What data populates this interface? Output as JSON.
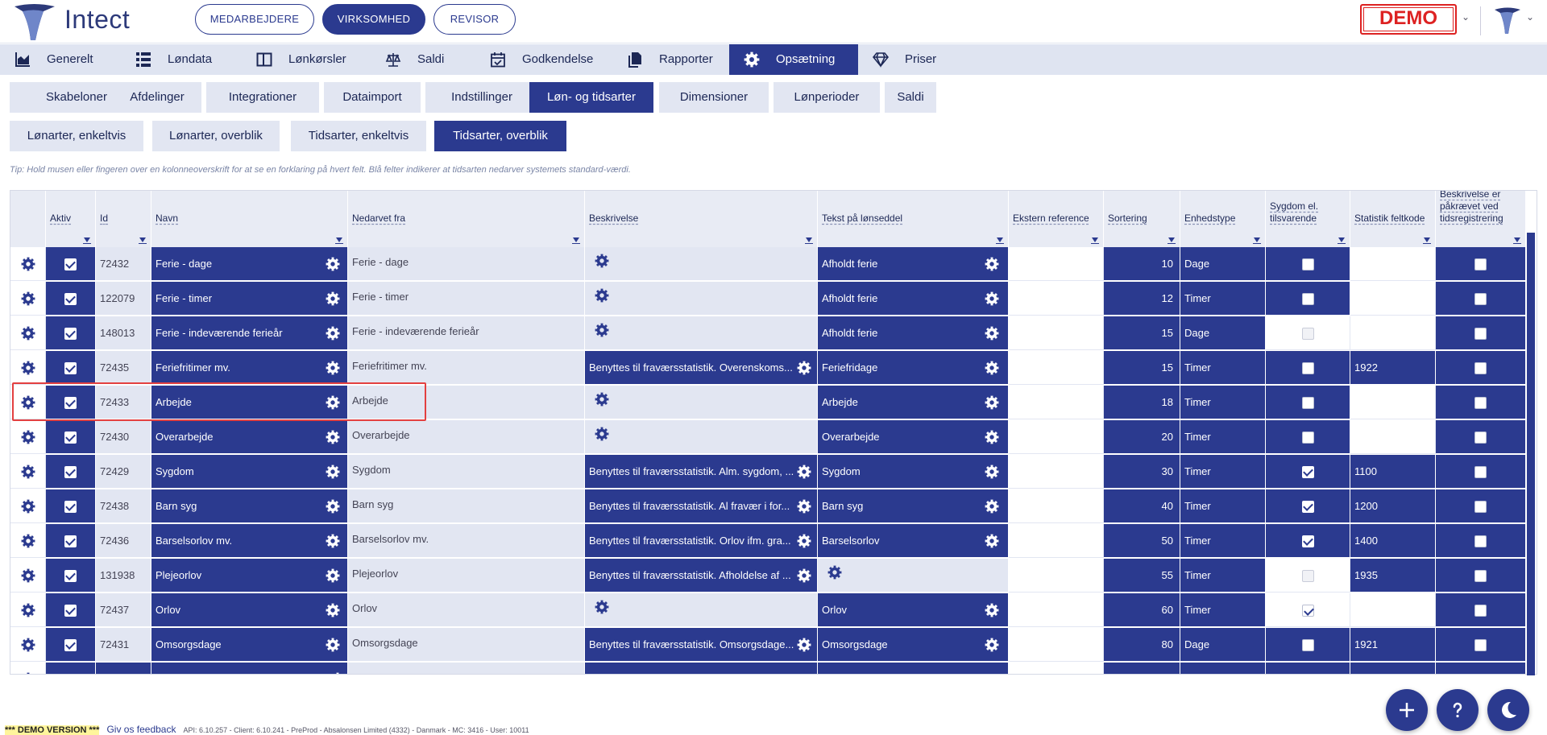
{
  "header": {
    "brand": "Intect",
    "pills": [
      "MEDARBEJDERE",
      "VIRKSOMHED",
      "REVISOR"
    ],
    "active_pill": 1,
    "demo_label": "DEMO"
  },
  "nav": {
    "items": [
      {
        "label": "Generelt",
        "icon": "chart-icon"
      },
      {
        "label": "Løndata",
        "icon": "table-icon"
      },
      {
        "label": "Lønkørsler",
        "icon": "columns-icon"
      },
      {
        "label": "Saldi",
        "icon": "scale-icon"
      },
      {
        "label": "Godkendelse",
        "icon": "calendar-check-icon"
      },
      {
        "label": "Rapporter",
        "icon": "files-icon"
      },
      {
        "label": "Opsætning",
        "icon": "gear-icon"
      },
      {
        "label": "Priser",
        "icon": "diamond-icon"
      }
    ],
    "active": 6
  },
  "subtabs_row1": [
    "Skabeloner",
    "Afdelinger",
    "Integrationer",
    "Dataimport",
    "Indstillinger",
    "Løn- og tidsarter",
    "Dimensioner",
    "Lønperioder",
    "Saldi"
  ],
  "subtabs_row2": [
    "Lønarter, enkeltvis",
    "Lønarter, overblik",
    "Tidsarter, enkeltvis",
    "Tidsarter, overblik"
  ],
  "tip": "Tip: Hold musen eller fingeren over en kolonneoverskrift for at se en forklaring på hvert felt. Blå felter indikerer at tidsarten nedarver systemets standard-værdi.",
  "columns": {
    "aktiv": "Aktiv",
    "id": "Id",
    "navn": "Navn",
    "nedarvet": "Nedarvet fra",
    "beskrivelse": "Beskrivelse",
    "tekst": "Tekst på lønseddel",
    "ekstern": "Ekstern reference",
    "sortering": "Sortering",
    "enhed": "Enhedstype",
    "sygdom": "Sygdom el. tilsvarende",
    "statistik": "Statistik feltkode",
    "beskrivelse_krav": "Beskrivelse er påkrævet ved tidsregistrering"
  },
  "rows": [
    {
      "id": "72432",
      "navn": "Ferie - dage",
      "nedarvet": "Ferie - dage",
      "beskrivelse": "",
      "tekst": "Afholdt ferie",
      "sortering": "10",
      "enhed": "Dage",
      "sygdom": "off",
      "statistik": "",
      "stat_dark": false
    },
    {
      "id": "122079",
      "navn": "Ferie - timer",
      "nedarvet": "Ferie - timer",
      "beskrivelse": "",
      "tekst": "Afholdt ferie",
      "sortering": "12",
      "enhed": "Timer",
      "sygdom": "off",
      "statistik": "",
      "stat_dark": false
    },
    {
      "id": "148013",
      "navn": "Ferie - indeværende ferieår",
      "nedarvet": "Ferie - indeværende ferieår",
      "beskrivelse": "",
      "tekst": "Afholdt ferie",
      "sortering": "15",
      "enhed": "Dage",
      "sygdom": "dis",
      "statistik": "",
      "stat_dark": false
    },
    {
      "id": "72435",
      "navn": "Feriefritimer mv.",
      "nedarvet": "Feriefritimer mv.",
      "beskrivelse": "Benyttes til fraværsstatistik. Overenskoms...",
      "tekst": "Feriefridage",
      "sortering": "15",
      "enhed": "Timer",
      "sygdom": "off",
      "statistik": "1922",
      "stat_dark": true
    },
    {
      "id": "72433",
      "navn": "Arbejde",
      "nedarvet": "Arbejde",
      "beskrivelse": "",
      "tekst": "Arbejde",
      "sortering": "18",
      "enhed": "Timer",
      "sygdom": "off",
      "statistik": "",
      "stat_dark": false
    },
    {
      "id": "72430",
      "navn": "Overarbejde",
      "nedarvet": "Overarbejde",
      "beskrivelse": "",
      "tekst": "Overarbejde",
      "sortering": "20",
      "enhed": "Timer",
      "sygdom": "off",
      "statistik": "",
      "stat_dark": false
    },
    {
      "id": "72429",
      "navn": "Sygdom",
      "nedarvet": "Sygdom",
      "beskrivelse": "Benyttes til fraværsstatistik. Alm. sygdom, ...",
      "tekst": "Sygdom",
      "sortering": "30",
      "enhed": "Timer",
      "sygdom": "on",
      "statistik": "1100",
      "stat_dark": true
    },
    {
      "id": "72438",
      "navn": "Barn syg",
      "nedarvet": "Barn syg",
      "beskrivelse": "Benyttes til fraværsstatistik. Al fravær i for...",
      "tekst": "Barn syg",
      "sortering": "40",
      "enhed": "Timer",
      "sygdom": "on",
      "statistik": "1200",
      "stat_dark": true
    },
    {
      "id": "72436",
      "navn": "Barselsorlov mv.",
      "nedarvet": "Barselsorlov mv.",
      "beskrivelse": "Benyttes til fraværsstatistik. Orlov ifm. gra...",
      "tekst": "Barselsorlov",
      "sortering": "50",
      "enhed": "Timer",
      "sygdom": "on",
      "statistik": "1400",
      "stat_dark": true
    },
    {
      "id": "131938",
      "navn": "Plejeorlov",
      "nedarvet": "Plejeorlov",
      "beskrivelse": "Benyttes til fraværsstatistik. Afholdelse af ...",
      "tekst": "",
      "sortering": "55",
      "enhed": "Timer",
      "sygdom": "dis",
      "statistik": "1935",
      "stat_dark": true
    },
    {
      "id": "72437",
      "navn": "Orlov",
      "nedarvet": "Orlov",
      "beskrivelse": "",
      "tekst": "Orlov",
      "sortering": "60",
      "enhed": "Timer",
      "sygdom": "onw",
      "statistik": "",
      "stat_dark": false
    },
    {
      "id": "72431",
      "navn": "Omsorgsdage",
      "nedarvet": "Omsorgsdage",
      "beskrivelse": "Benyttes til fraværsstatistik. Omsorgsdage...",
      "tekst": "Omsorgsdage",
      "sortering": "80",
      "enhed": "Dage",
      "sygdom": "off",
      "statistik": "1921",
      "stat_dark": true
    }
  ],
  "footer": {
    "demo_version": "*** DEMO VERSION ***",
    "feedback": "Giv os feedback",
    "meta": "API: 6.10.257 - Client: 6.10.241 - PreProd - Absalonsen Limited (4332) - Danmark - MC: 3416 - User: 10011"
  },
  "fabs": [
    {
      "icon": "plus-icon"
    },
    {
      "icon": "help-icon"
    },
    {
      "icon": "moon-icon"
    }
  ]
}
